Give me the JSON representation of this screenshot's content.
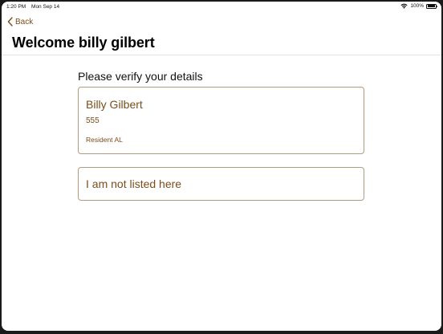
{
  "status_bar": {
    "time": "1:20 PM",
    "date": "Mon Sep 14",
    "battery": "100%",
    "wifi_icon": "wifi-icon",
    "battery_icon": "battery-icon"
  },
  "nav": {
    "back_label": "Back",
    "back_icon": "chevron-left-icon",
    "title": "Welcome billy gilbert"
  },
  "main": {
    "heading": "Please verify your details",
    "person_card": {
      "name": "Billy Gilbert",
      "number": "555",
      "role": "Resident AL"
    },
    "not_listed_label": "I am not listed here"
  },
  "colors": {
    "accent": "#7a4e1c",
    "card_border": "#b49a7e",
    "background": "#ffffff",
    "text": "#111111"
  }
}
